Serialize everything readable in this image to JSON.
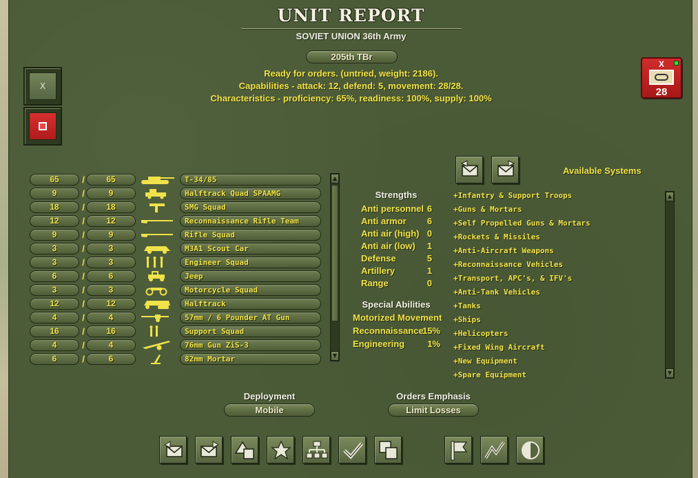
{
  "header": {
    "title": "UNIT REPORT",
    "subtitle": "SOVIET UNION 36th Army",
    "unit_name": "205th TBr"
  },
  "status_lines": [
    "Ready for orders. (untried, weight: 2186).",
    "Capabilities - attack: 12, defend: 5, movement: 28/28.",
    "Characteristics - proficiency: 65%, readiness: 100%, supply: 100%"
  ],
  "left_buttons": {
    "close_label": "X"
  },
  "counter": {
    "size_label": "X",
    "value": "28",
    "colors": {
      "body": "#c42020",
      "indicator": "#34e034"
    }
  },
  "equipment": [
    {
      "current": "65",
      "max": "65",
      "icon": "tank-icon",
      "name": "T-34/85"
    },
    {
      "current": "9",
      "max": "9",
      "icon": "truck-aa-icon",
      "name": "Halftrack Quad SPAAMG"
    },
    {
      "current": "18",
      "max": "18",
      "icon": "smg-icon",
      "name": "SMG Squad"
    },
    {
      "current": "12",
      "max": "12",
      "icon": "rifle-icon",
      "name": "Reconnaissance Rifle Team"
    },
    {
      "current": "9",
      "max": "9",
      "icon": "rifle-icon",
      "name": "Rifle Squad"
    },
    {
      "current": "3",
      "max": "3",
      "icon": "armored-car-icon",
      "name": "M3A1 Scout Car"
    },
    {
      "current": "3",
      "max": "3",
      "icon": "engineers-icon",
      "name": "Engineer Squad"
    },
    {
      "current": "6",
      "max": "6",
      "icon": "jeep-icon",
      "name": "Jeep"
    },
    {
      "current": "3",
      "max": "3",
      "icon": "motorcycle-icon",
      "name": "Motorcycle Squad"
    },
    {
      "current": "12",
      "max": "12",
      "icon": "halftrack-icon",
      "name": "Halftrack"
    },
    {
      "current": "4",
      "max": "4",
      "icon": "at-gun-icon",
      "name": "57mm / 6 Pounder AT Gun"
    },
    {
      "current": "16",
      "max": "16",
      "icon": "support-troops-icon",
      "name": "Support Squad"
    },
    {
      "current": "4",
      "max": "4",
      "icon": "field-gun-icon",
      "name": "76mm Gun ZiS-3"
    },
    {
      "current": "6",
      "max": "6",
      "icon": "mortar-icon",
      "name": "82mm Mortar"
    }
  ],
  "strengths": {
    "title": "Strengths",
    "items": [
      {
        "label": "Anti personnel",
        "value": "6"
      },
      {
        "label": "Anti armor",
        "value": "6"
      },
      {
        "label": "Anti air (high)",
        "value": "0"
      },
      {
        "label": "Anti air (low)",
        "value": "1"
      },
      {
        "label": "Defense",
        "value": "5"
      },
      {
        "label": "Artillery",
        "value": "1"
      },
      {
        "label": "Range",
        "value": "0"
      }
    ]
  },
  "special_abilities": {
    "title": "Special Abilities",
    "items": [
      {
        "label": "Motorized Movement",
        "value": ""
      },
      {
        "label": "Reconnaissance",
        "value": "15%"
      },
      {
        "label": "Engineering",
        "value": "1%"
      }
    ]
  },
  "available_systems": {
    "title": "Available Systems",
    "items": [
      "+Infantry & Support Troops",
      "+Guns & Mortars",
      "+Self Propelled Guns & Mortars",
      "+Rockets & Missiles",
      "+Anti-Aircraft Weapons",
      "+Reconnaissance Vehicles",
      "+Transport, APC's, & IFV's",
      "+Anti-Tank Vehicles",
      "+Tanks",
      "+Ships",
      "+Helicopters",
      "+Fixed Wing Aircraft",
      "+New Equipment",
      "+Spare Equipment"
    ]
  },
  "deployment": {
    "label": "Deployment",
    "value": "Mobile"
  },
  "orders_emphasis": {
    "label": "Orders Emphasis",
    "value": "Limit Losses"
  },
  "bottom_toolbar": [
    "prev-unit-icon",
    "next-unit-icon",
    "org-shapes-icon",
    "star-icon",
    "hierarchy-icon",
    "checkmark-icon",
    "overlap-squares-icon",
    "flag-icon",
    "trend-icon",
    "half-circle-icon"
  ],
  "theme": {
    "panel": "#4b5b37",
    "accent_yellow": "#f0e24a",
    "title_white": "#f4f0e0"
  }
}
